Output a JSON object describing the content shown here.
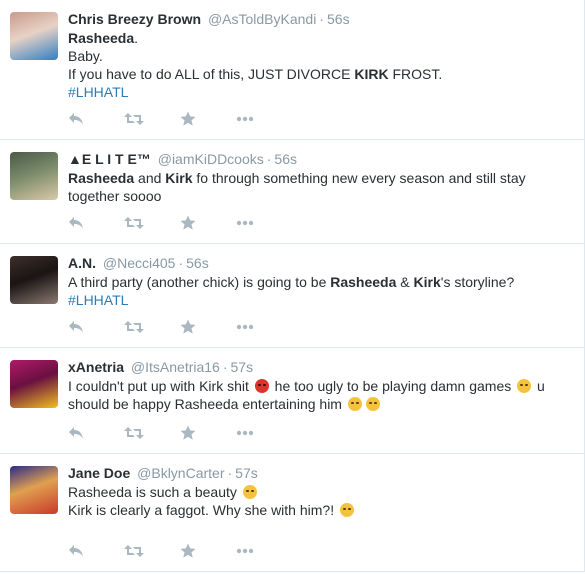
{
  "tweets": [
    {
      "name": "Chris Breezy Brown",
      "handle": "@AsToldByKandi",
      "time": "56s",
      "avatar_colors": [
        "#c99b8c",
        "#2f7fc4",
        "#e7d2c5"
      ],
      "lines": [
        {
          "segments": [
            {
              "t": "Rasheeda",
              "b": true
            },
            {
              "t": "."
            }
          ]
        },
        {
          "segments": [
            {
              "t": "Baby."
            }
          ]
        },
        {
          "segments": [
            {
              "t": "If you have to do ALL of this, JUST DIVORCE "
            },
            {
              "t": "KIRK",
              "b": true
            },
            {
              "t": " FROST."
            }
          ]
        },
        {
          "segments": [
            {
              "t": "#LHHATL",
              "tag": true
            }
          ]
        }
      ]
    },
    {
      "name": "▲E L I T E™",
      "handle": "@iamKiDDcooks",
      "time": "56s",
      "avatar_colors": [
        "#4a5a48",
        "#d9c9a8",
        "#7a8a6a"
      ],
      "lines": [
        {
          "segments": [
            {
              "t": "Rasheeda",
              "b": true
            },
            {
              "t": " and "
            },
            {
              "t": "Kirk",
              "b": true
            },
            {
              "t": " fo through something new every season and still stay"
            }
          ]
        },
        {
          "segments": [
            {
              "t": "together soooo"
            }
          ]
        }
      ]
    },
    {
      "name": "A.N.",
      "handle": "@Necci405",
      "time": "56s",
      "avatar_colors": [
        "#3d2f2a",
        "#8a7a70",
        "#1a1414"
      ],
      "lines": [
        {
          "segments": [
            {
              "t": "A third party (another chick) is going to be "
            },
            {
              "t": "Rasheeda",
              "b": true
            },
            {
              "t": " & "
            },
            {
              "t": "Kirk",
              "b": true
            },
            {
              "t": "'s storyline?"
            }
          ]
        },
        {
          "segments": [
            {
              "t": "#LHHATL",
              "tag": true
            }
          ]
        }
      ]
    },
    {
      "name": "xAnetria",
      "handle": "@ItsAnetria16",
      "time": "57s",
      "avatar_colors": [
        "#b01a6a",
        "#f0c020",
        "#6a1040"
      ],
      "lines": [
        {
          "segments": [
            {
              "t": "I couldn't put up with Kirk shit "
            },
            {
              "emoji": "angry"
            },
            {
              "t": " he too ugly to be playing damn games "
            },
            {
              "emoji": "cry-laugh"
            },
            {
              "t": " u"
            }
          ]
        },
        {
          "segments": [
            {
              "t": "should be happy Rasheeda entertaining him "
            },
            {
              "emoji": "tired"
            },
            {
              "emoji": "unamused"
            }
          ]
        }
      ]
    },
    {
      "name": "Jane Doe",
      "handle": "@BklynCarter",
      "time": "57s",
      "avatar_colors": [
        "#2a2a8a",
        "#c83a2a",
        "#e0a050"
      ],
      "lines": [
        {
          "segments": [
            {
              "t": "Rasheeda is such a beauty "
            },
            {
              "emoji": "tired"
            }
          ]
        },
        {
          "segments": [
            {
              "t": " "
            }
          ]
        },
        {
          "segments": [
            {
              "t": "Kirk is clearly a faggot. Why she with him?! "
            },
            {
              "emoji": "confused"
            }
          ]
        }
      ]
    }
  ],
  "actions": [
    "reply-icon",
    "retweet-icon",
    "favorite-icon",
    "more-icon"
  ]
}
